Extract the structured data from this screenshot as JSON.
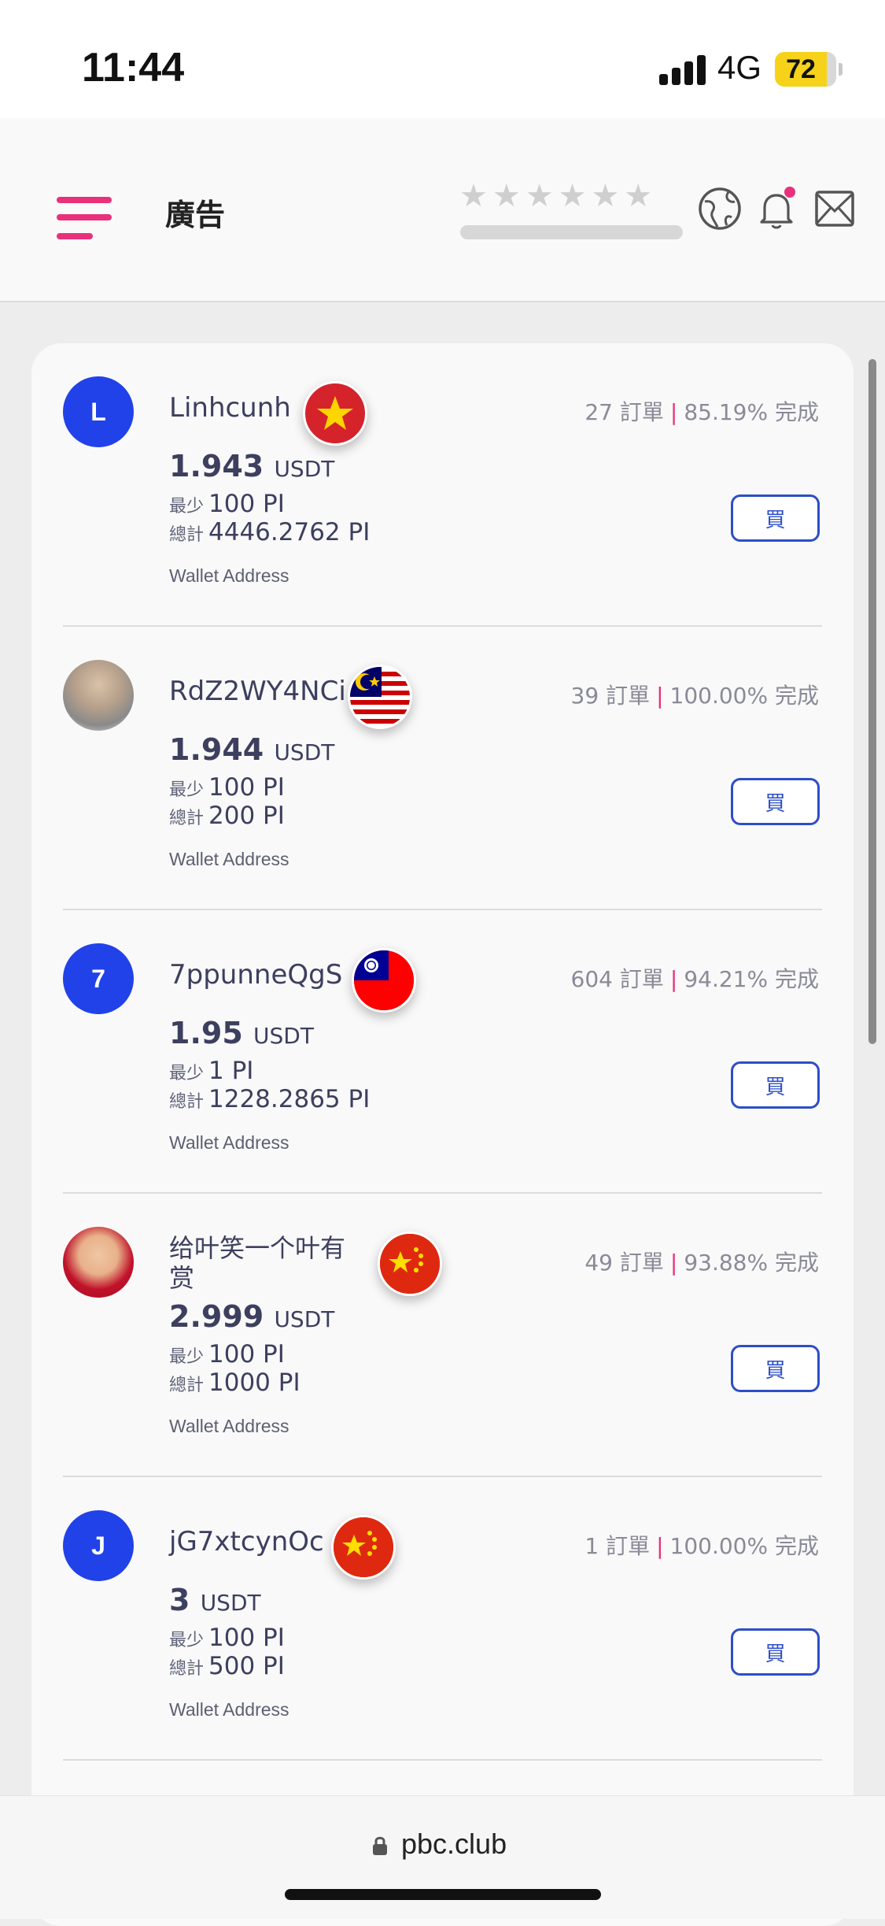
{
  "status_bar": {
    "time": "11:44",
    "network": "4G",
    "battery": "72"
  },
  "header": {
    "title": "廣告",
    "rating_stars": "★★★★★★",
    "icons": [
      "menu-icon",
      "globe-icon",
      "bell-icon",
      "mail-icon"
    ],
    "accent_color": "#e8317a"
  },
  "labels": {
    "min": "最少",
    "total": "總計",
    "wallet": "Wallet Address",
    "buy": "買",
    "orders_suffix": "訂單",
    "complete_suffix": "完成"
  },
  "listings": [
    {
      "username": "Linhcunh",
      "avatar_letter": "L",
      "flag": "vietnam",
      "orders": "27 訂單",
      "completion": "85.19% 完成",
      "price": "1.943",
      "currency": "USDT",
      "min": "100 PI",
      "total": "4446.2762 PI",
      "wallet": "Wallet Address",
      "buy": "買"
    },
    {
      "username": "RdZ2WY4NCi",
      "avatar_letter": "",
      "flag": "malaysia",
      "orders": "39 訂單",
      "completion": "100.00% 完成",
      "price": "1.944",
      "currency": "USDT",
      "min": "100 PI",
      "total": "200 PI",
      "wallet": "Wallet Address",
      "buy": "買"
    },
    {
      "username": "7ppunneQgS",
      "avatar_letter": "7",
      "flag": "taiwan",
      "orders": "604 訂單",
      "completion": "94.21% 完成",
      "price": "1.95",
      "currency": "USDT",
      "min": "1 PI",
      "total": "1228.2865 PI",
      "wallet": "Wallet Address",
      "buy": "買"
    },
    {
      "username": "给叶笑一个叶有赏",
      "avatar_letter": "",
      "flag": "china",
      "orders": "49 訂單",
      "completion": "93.88% 完成",
      "price": "2.999",
      "currency": "USDT",
      "min": "100 PI",
      "total": "1000 PI",
      "wallet": "Wallet Address",
      "buy": "買"
    },
    {
      "username": "jG7xtcynOc",
      "avatar_letter": "J",
      "flag": "china",
      "orders": "1 訂單",
      "completion": "100.00% 完成",
      "price": "3",
      "currency": "USDT",
      "min": "100 PI",
      "total": "500 PI",
      "wallet": "Wallet Address",
      "buy": "買"
    }
  ],
  "browser": {
    "url": "pbc.club"
  }
}
